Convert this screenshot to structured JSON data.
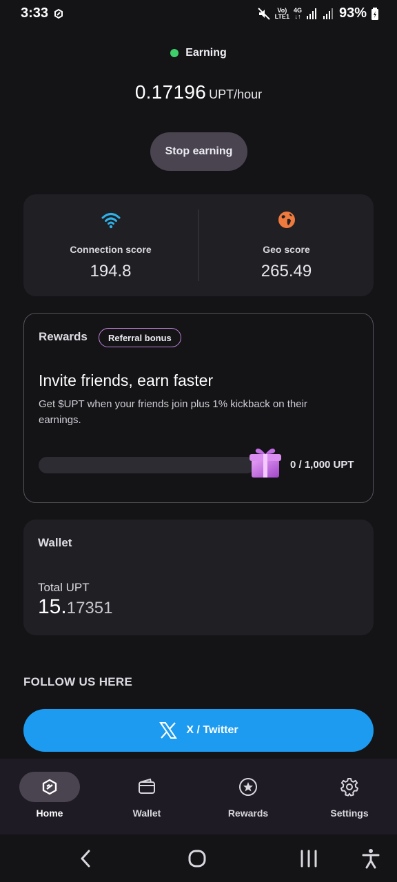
{
  "status_bar": {
    "time": "3:33",
    "network_top": "Vo)",
    "network_bottom": "LTE1",
    "data_type_top": "4G",
    "data_type_bottom": "↓↑",
    "battery": "93%"
  },
  "earning": {
    "status": "Earning",
    "status_color": "#3ecf6b",
    "rate_value": "0.17196",
    "rate_unit": "UPT/hour",
    "stop_button": "Stop earning"
  },
  "scores": {
    "connection_label": "Connection score",
    "connection_value": "194.8",
    "connection_icon": "wifi-icon",
    "geo_label": "Geo score",
    "geo_value": "265.49",
    "geo_icon": "globe-icon"
  },
  "rewards": {
    "title": "Rewards",
    "badge": "Referral bonus",
    "headline": "Invite friends, earn faster",
    "description": "Get $UPT when your friends join plus 1% kickback on their earnings.",
    "progress_fraction": 0,
    "progress_text": "0 / 1,000 UPT",
    "gift_icon": "gift-icon"
  },
  "wallet": {
    "title": "Wallet",
    "total_label": "Total UPT",
    "total_int": "15.",
    "total_dec": "17351"
  },
  "follow": {
    "title": "FOLLOW US HERE",
    "twitter_label": "X / Twitter",
    "twitter_color": "#1d9bf0"
  },
  "nav": {
    "items": [
      {
        "label": "Home",
        "icon": "home-logo-icon",
        "active": true
      },
      {
        "label": "Wallet",
        "icon": "wallet-icon",
        "active": false
      },
      {
        "label": "Rewards",
        "icon": "star-circle-icon",
        "active": false
      },
      {
        "label": "Settings",
        "icon": "gear-icon",
        "active": false
      }
    ]
  },
  "system_nav": {
    "back_icon": "back-chevron-icon",
    "home_icon": "home-circle-icon",
    "recents_icon": "recents-icon",
    "accessibility_icon": "accessibility-icon"
  },
  "theme": {
    "background": "#141417",
    "card": "#1f1f24",
    "accent_purple": "#c184d8"
  }
}
